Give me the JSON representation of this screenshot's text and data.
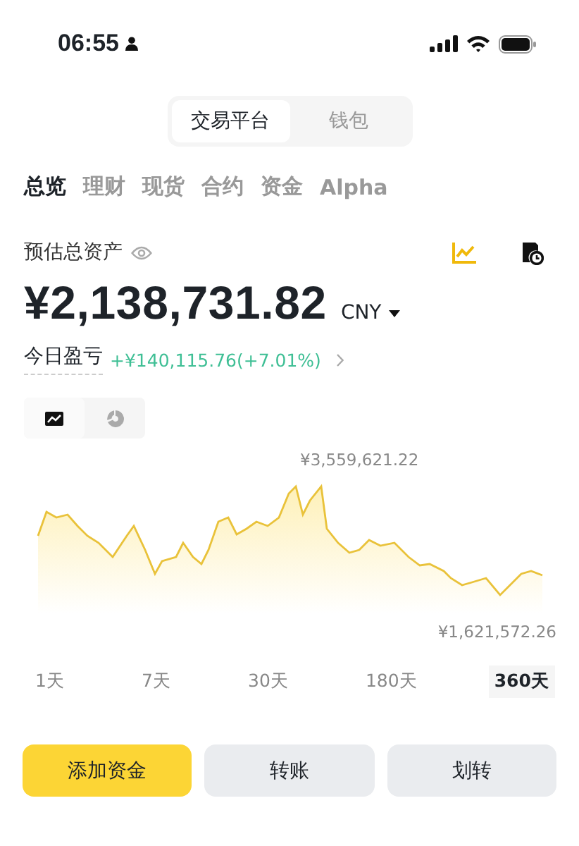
{
  "status_bar": {
    "time": "06:55"
  },
  "segments": [
    {
      "label": "交易平台",
      "selected": true
    },
    {
      "label": "钱包",
      "selected": false
    }
  ],
  "tabs": [
    {
      "label": "总览",
      "selected": true
    },
    {
      "label": "理财",
      "selected": false
    },
    {
      "label": "现货",
      "selected": false
    },
    {
      "label": "合约",
      "selected": false
    },
    {
      "label": "资金",
      "selected": false
    },
    {
      "label": "Alpha",
      "selected": false
    }
  ],
  "balance": {
    "label": "预估总资产",
    "amount": "¥2,138,731.82",
    "currency": "CNY"
  },
  "pnl": {
    "label": "今日盈亏",
    "value": "+¥140,115.76(+7.01%)"
  },
  "view_toggle": [
    {
      "kind": "line",
      "selected": true
    },
    {
      "kind": "pie",
      "selected": false
    }
  ],
  "chart": {
    "max_label": "¥3,559,621.22",
    "min_label": "¥1,621,572.26"
  },
  "ranges": [
    {
      "label": "1天",
      "selected": false
    },
    {
      "label": "7天",
      "selected": false
    },
    {
      "label": "30天",
      "selected": false
    },
    {
      "label": "180天",
      "selected": false
    },
    {
      "label": "360天",
      "selected": true
    }
  ],
  "buttons": [
    {
      "label": "添加资金",
      "kind": "primary"
    },
    {
      "label": "转账",
      "kind": "secondary"
    },
    {
      "label": "划转",
      "kind": "secondary"
    }
  ]
}
